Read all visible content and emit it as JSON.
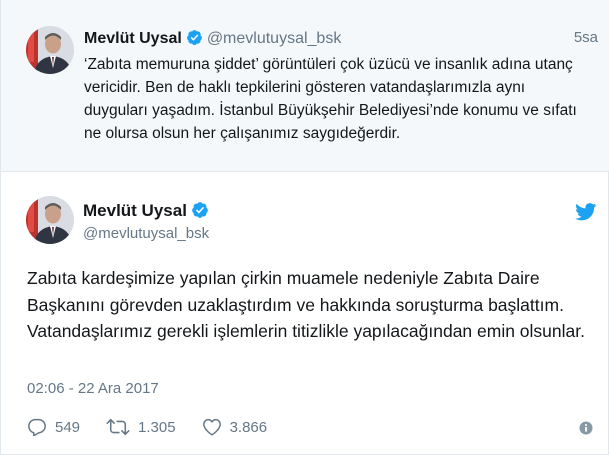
{
  "quoted_tweet": {
    "name": "Mevlüt Uysal",
    "handle": "@mevlutuysal_bsk",
    "time": "5sa",
    "text": "‘Zabıta memuruna şiddet’ görüntüleri çok üzücü ve insanlık adına utanç vericidir. Ben de haklı tepkilerini gösteren vatandaşlarımızla aynı duyguları yaşadım. İstanbul Büyükşehir Belediyesi’nde konumu ve sıfatı ne olursa olsun her çalışanımız saygıdeğerdir.",
    "avatar_icon": "profile-photo",
    "verified_icon": "verified-badge-icon"
  },
  "main_tweet": {
    "name": "Mevlüt Uysal",
    "handle": "@mevlutuysal_bsk",
    "text": "Zabıta kardeşimize yapılan çirkin muamele nedeniyle Zabıta Daire Başkanını görevden uzaklaştırdım ve hakkında soruşturma başlattım. Vatandaşlarımız gerekli işlemlerin titizlikle yapılacağından emin olsunlar.",
    "date": "02:06 - 22 Ara 2017",
    "replies": "549",
    "retweets": "1.305",
    "likes": "3.866",
    "brand_icon": "twitter-bird-icon",
    "info_icon": "info-icon"
  },
  "colors": {
    "twitter_blue": "#1da1f2",
    "secondary_text": "#657786",
    "primary_text": "#14171a",
    "quoted_bg": "#f5f8fa"
  }
}
